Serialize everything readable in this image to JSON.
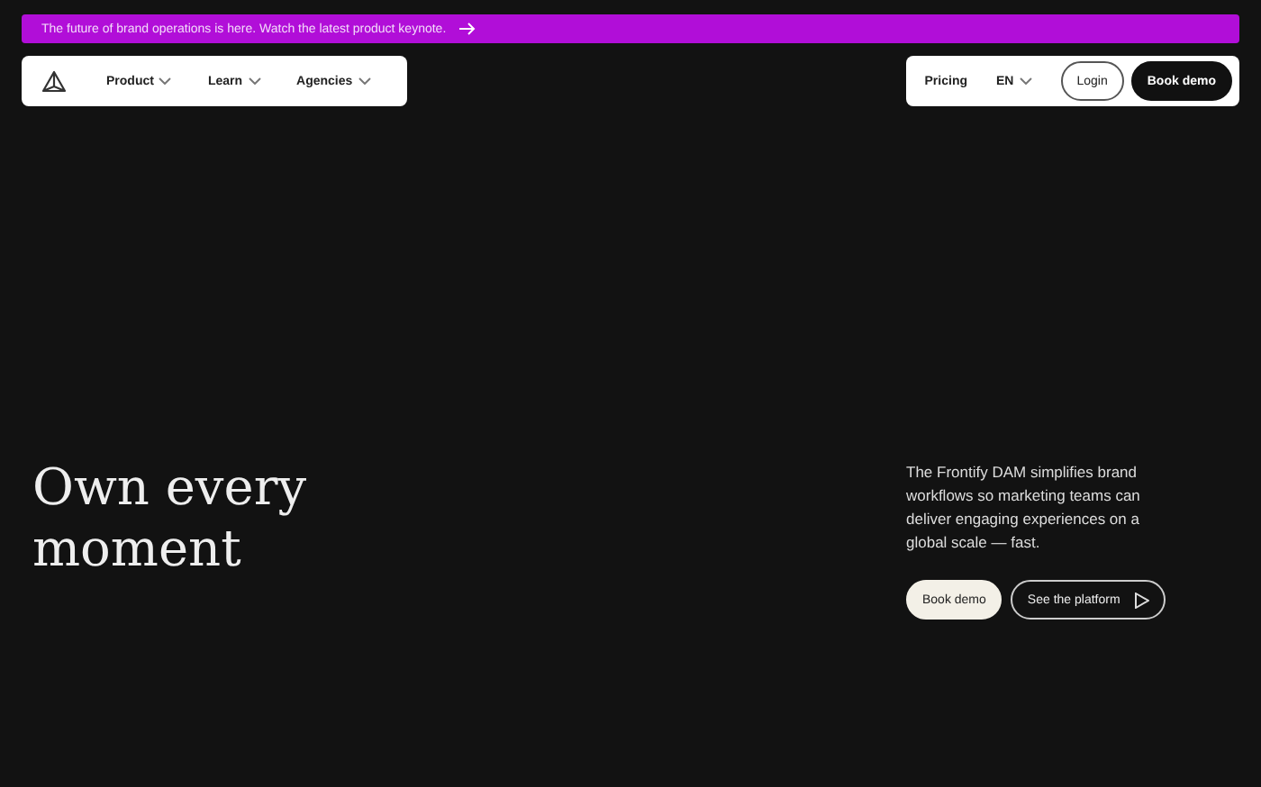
{
  "banner": {
    "text": "The future of brand operations is here. Watch the latest product keynote."
  },
  "nav": {
    "items": [
      {
        "label": "Product",
        "dropdown": true
      },
      {
        "label": "Learn",
        "dropdown": true
      },
      {
        "label": "Agencies",
        "dropdown": true
      }
    ],
    "right_items": [
      {
        "label": "Pricing",
        "dropdown": false
      },
      {
        "label": "EN",
        "dropdown": true
      }
    ],
    "buttons": [
      {
        "label": "Login",
        "kind": "outline"
      },
      {
        "label": "Book demo",
        "kind": "dark"
      }
    ]
  },
  "hero": {
    "heading": "Own every moment",
    "description": "The Frontify DAM simplifies brand workflows so marketing teams can deliver engaging experiences on a global scale — fast.",
    "buttons": [
      {
        "label": "Book demo",
        "kind": "light",
        "play": false
      },
      {
        "label": "See the platform",
        "kind": "ghost",
        "play": true
      }
    ]
  }
}
